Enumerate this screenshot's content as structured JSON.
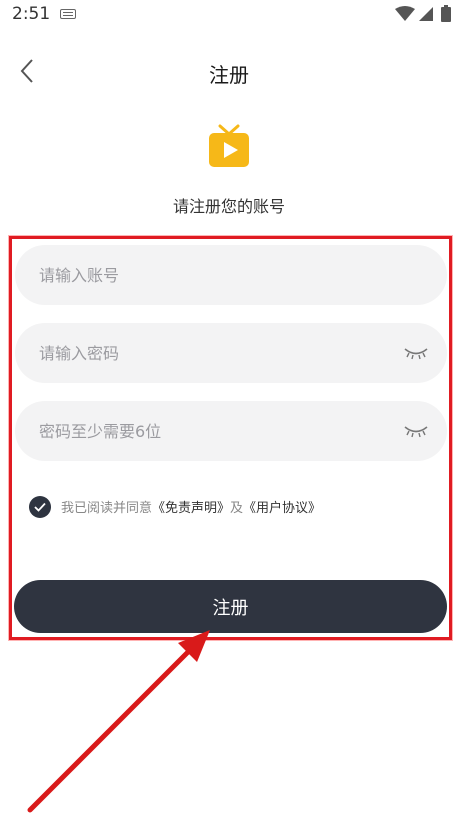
{
  "status_bar": {
    "time": "2:51"
  },
  "header": {
    "title": "注册"
  },
  "subtitle": "请注册您的账号",
  "form": {
    "account_placeholder": "请输入账号",
    "password_placeholder": "请输入密码",
    "confirm_placeholder": "密码至少需要6位"
  },
  "agreement": {
    "prefix": "我已阅读并同意",
    "disclaimer": "《免责声明》",
    "joiner": "及",
    "user_agreement": "《用户协议》",
    "checked": true
  },
  "register_button_label": "注册",
  "colors": {
    "accent_dark": "#2f3440",
    "logo_yellow": "#f6b818",
    "highlight_red": "#e01b22"
  },
  "icons": [
    "back-icon",
    "tv-play-icon",
    "eye-closed-icon",
    "check-icon",
    "wifi-icon",
    "signal-icon",
    "battery-icon",
    "keyboard-icon"
  ]
}
